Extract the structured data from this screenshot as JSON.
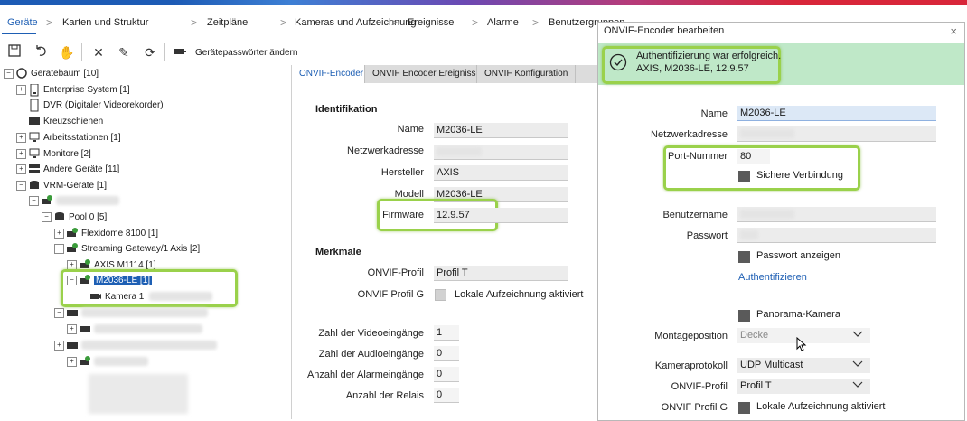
{
  "menu": {
    "items": [
      "Geräte",
      "Karten und Struktur",
      "Zeitpläne",
      "Kameras und Aufzeichnung",
      "Ereignisse",
      "Alarme",
      "Benutzergruppen"
    ],
    "separator": ">"
  },
  "toolbar": {
    "change_passwords_label": "Gerätepasswörter ändern"
  },
  "tree": {
    "root": "Gerätebaum [10]",
    "enterprise": "Enterprise System [1]",
    "dvr": "DVR (Digitaler Videorekorder)",
    "kreuzschienen": "Kreuzschienen",
    "arbeitsstationen": "Arbeitsstationen [1]",
    "monitore": "Monitore [2]",
    "andere": "Andere Geräte [11]",
    "vrm": "VRM-Geräte [1]",
    "pool": "Pool 0 [5]",
    "flexidome": "Flexidome 8100 [1]",
    "streaming": "Streaming Gateway/1 Axis [2]",
    "axis_m1114": "AXIS M1114 [1]",
    "m2036": "M2036-LE [1]",
    "kamera1": "Kamera 1"
  },
  "panel": {
    "tabs": [
      "ONVIF-Encoder",
      "ONVIF Encoder Ereignisse",
      "ONVIF Konfiguration"
    ],
    "identifikation": "Identifikation",
    "name_label": "Name",
    "name_value": "M2036-LE",
    "netz_label": "Netzwerkadresse",
    "hersteller_label": "Hersteller",
    "hersteller_value": "AXIS",
    "modell_label": "Modell",
    "modell_value": "M2036-LE",
    "firmware_label": "Firmware",
    "firmware_value": "12.9.57",
    "merkmale": "Merkmale",
    "onvif_profil_label": "ONVIF-Profil",
    "onvif_profil_value": "Profil T",
    "onvif_profil_g_label": "ONVIF Profil G",
    "lokale_label": "Lokale Aufzeichnung aktiviert",
    "video_label": "Zahl der Videoeingänge",
    "video_value": "1",
    "audio_label": "Zahl der Audioeingänge",
    "audio_value": "0",
    "alarm_label": "Anzahl der Alarmeingänge",
    "alarm_value": "0",
    "relais_label": "Anzahl der Relais",
    "relais_value": "0"
  },
  "dialog": {
    "title": "ONVIF-Encoder bearbeiten",
    "close": "×",
    "banner_line1": "Authentifizierung war erfolgreich.",
    "banner_line2": "AXIS, M2036-LE, 12.9.57",
    "name_label": "Name",
    "name_value": "M2036-LE",
    "netz_label": "Netzwerkadresse",
    "port_label": "Port-Nummer",
    "port_value": "80",
    "sichere_label": "Sichere Verbindung",
    "benutzer_label": "Benutzername",
    "passwort_label": "Passwort",
    "passwort_anzeigen_label": "Passwort anzeigen",
    "auth_link": "Authentifizieren",
    "panorama_label": "Panorama-Kamera",
    "montage_label": "Montageposition",
    "montage_value": "Decke",
    "protokoll_label": "Kameraprotokoll",
    "protokoll_value": "UDP Multicast",
    "profil_label": "ONVIF-Profil",
    "profil_value": "Profil T",
    "profil_g_label": "ONVIF Profil G",
    "lokale_label": "Lokale Aufzeichnung aktiviert"
  },
  "colors": {
    "accent": "#1e5fb4",
    "highlight": "#9ad14b",
    "banner": "#bfe8c8"
  }
}
